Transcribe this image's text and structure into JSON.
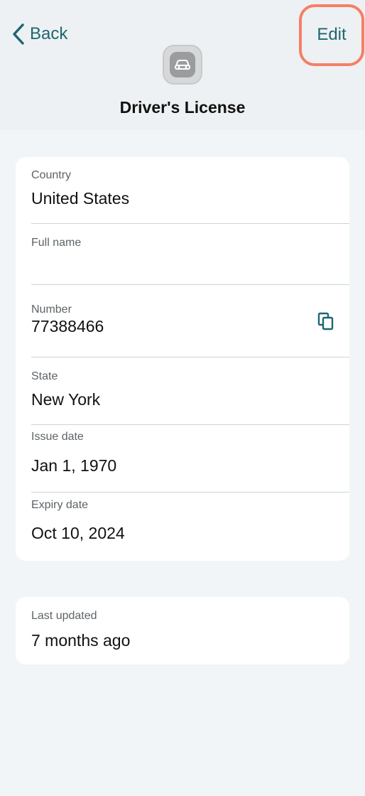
{
  "nav": {
    "back_label": "Back",
    "edit_label": "Edit"
  },
  "header": {
    "title": "Driver's License",
    "icon": "car-icon"
  },
  "fields": {
    "country": {
      "label": "Country",
      "value": "United States"
    },
    "full_name": {
      "label": "Full name",
      "value": ""
    },
    "number": {
      "label": "Number",
      "value": "77388466"
    },
    "state": {
      "label": "State",
      "value": "New York"
    },
    "issue_date": {
      "label": "Issue date",
      "value": "Jan 1, 1970"
    },
    "expiry_date": {
      "label": "Expiry date",
      "value": "Oct 10, 2024"
    }
  },
  "meta": {
    "label": "Last updated",
    "value": "7 months ago"
  },
  "colors": {
    "accent": "#1f6670",
    "highlight": "#f57f67",
    "background": "#f2f5f7"
  }
}
